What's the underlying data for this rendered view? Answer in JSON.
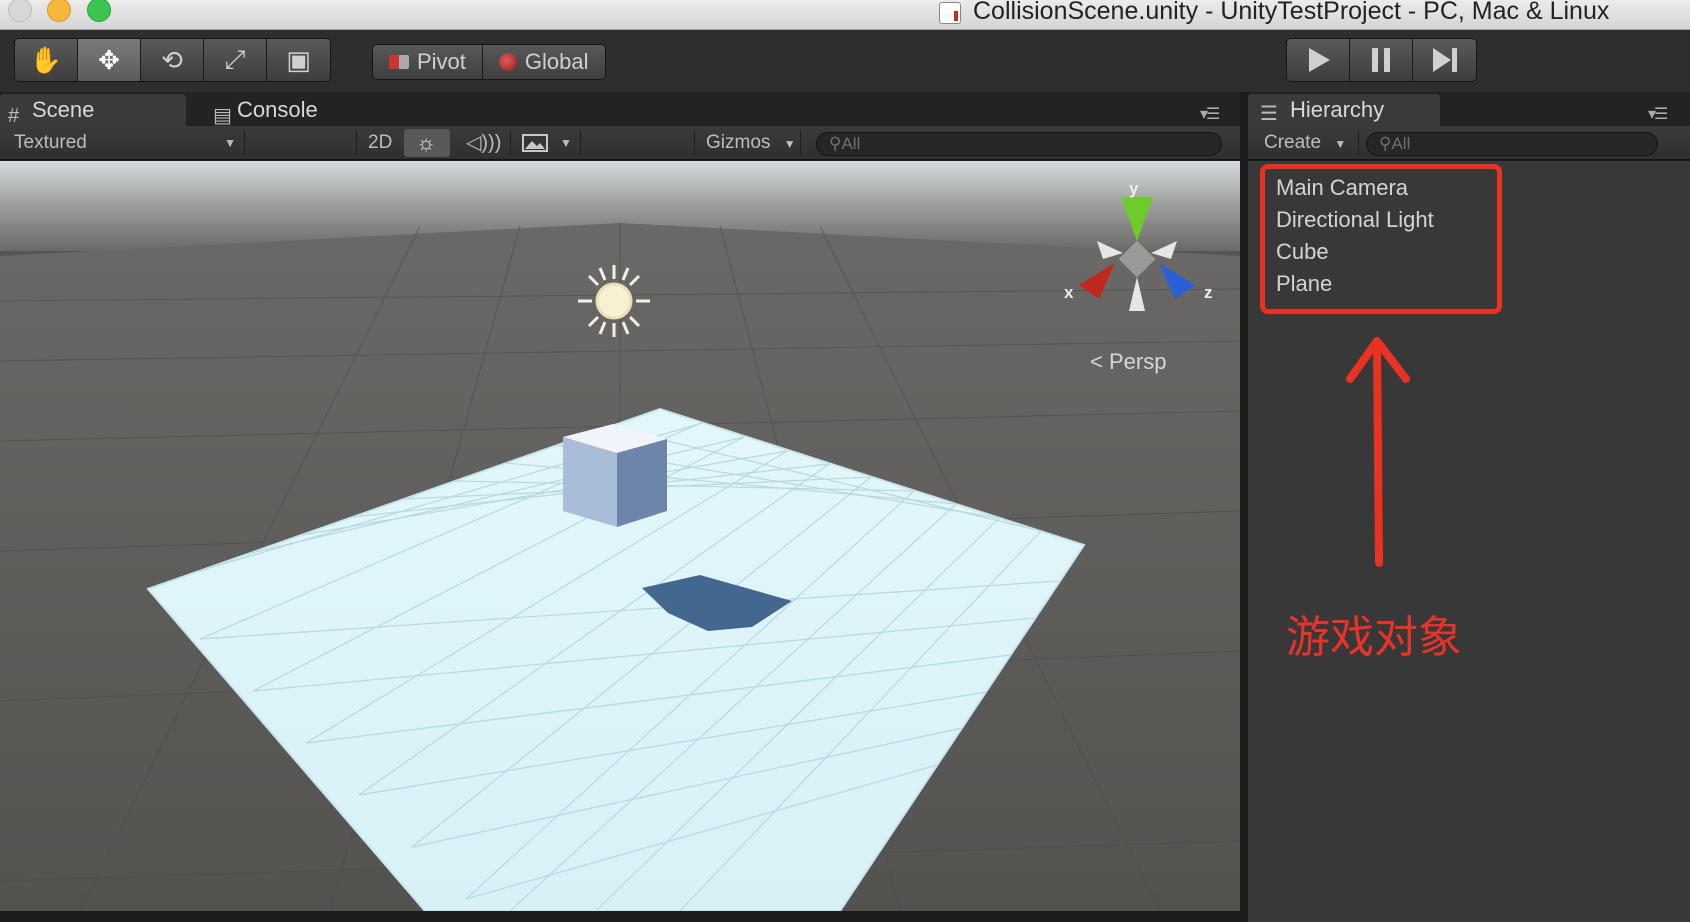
{
  "window": {
    "title": "CollisionScene.unity - UnityTestProject - PC, Mac & Linux"
  },
  "toolbar": {
    "transform_tools": [
      {
        "name": "hand-tool",
        "glyph": "✋"
      },
      {
        "name": "move-tool",
        "glyph": "✥"
      },
      {
        "name": "rotate-tool",
        "glyph": "⟲"
      },
      {
        "name": "scale-tool",
        "glyph": "⤢"
      },
      {
        "name": "rect-tool",
        "glyph": "▣"
      }
    ],
    "active_tool": 1,
    "pivot_label": "Pivot",
    "global_label": "Global"
  },
  "scene_panel": {
    "tabs": [
      {
        "label": "Scene",
        "icon": "grid-icon",
        "active": true
      },
      {
        "label": "Console",
        "icon": "console-icon",
        "active": false
      }
    ],
    "shading_mode": "Textured",
    "mode_2d": "2D",
    "gizmos_label": "Gizmos",
    "search_placeholder": "All",
    "persp_label": "Persp",
    "axis_labels": {
      "x": "x",
      "y": "y",
      "z": "z"
    }
  },
  "hierarchy": {
    "tab_label": "Hierarchy",
    "create_label": "Create",
    "search_placeholder": "All",
    "items": [
      "Main Camera",
      "Directional Light",
      "Cube",
      "Plane"
    ],
    "annotation": "游戏对象",
    "annotation_color": "#ea3223"
  },
  "colors": {
    "panel_bg": "#383838",
    "toolbar_bg": "#2e2e2e",
    "plane": "#dff6fb",
    "gizmo_x": "#c0281e",
    "gizmo_y": "#6dcc2a",
    "gizmo_z": "#2a5fd8"
  }
}
